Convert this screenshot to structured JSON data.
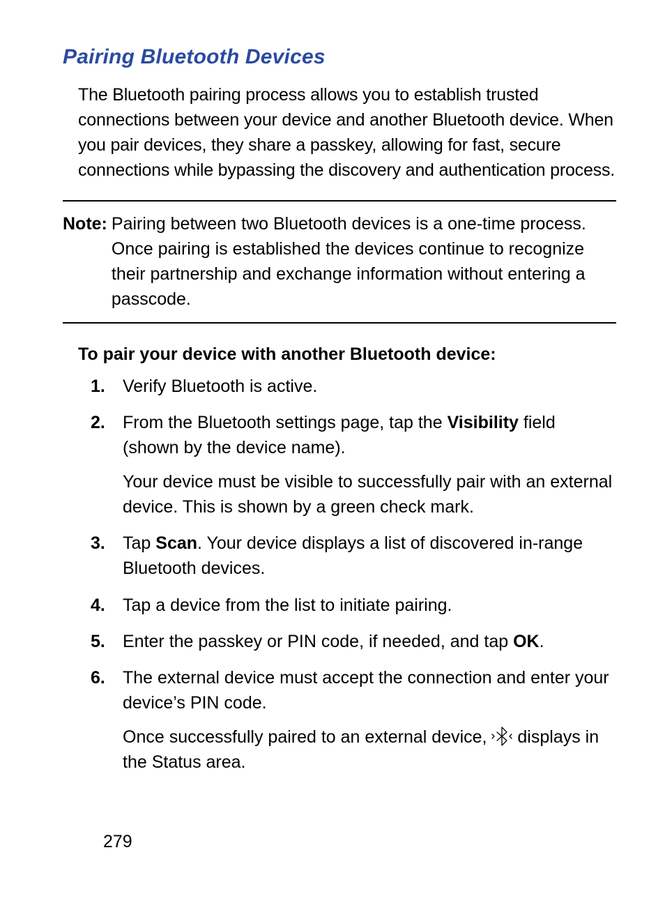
{
  "heading": "Pairing Bluetooth Devices",
  "intro": "The Bluetooth pairing process allows you to establish trusted connections between your device and another Bluetooth device. When you pair devices, they share a passkey, allowing for fast, secure connections while bypassing the discovery and authentication process.",
  "note_label": "Note:",
  "note_text": "Pairing between two Bluetooth devices is a one-time process. Once pairing is established the devices continue to recognize their partnership and exchange information without entering a passcode.",
  "procedure_heading": "To pair your device with another Bluetooth device:",
  "steps": {
    "s1": "Verify Bluetooth is active.",
    "s2_a": "From the Bluetooth settings page, tap the ",
    "s2_bold": "Visibility",
    "s2_b": " field (shown by the device name).",
    "s2_extra": "Your device must be visible to successfully pair with an external device. This is shown by a green check mark.",
    "s3_a": "Tap ",
    "s3_bold": "Scan",
    "s3_b": ". Your device displays a list of discovered in-range Bluetooth devices.",
    "s4": "Tap a device from the list to initiate pairing.",
    "s5_a": "Enter the passkey or PIN code, if needed, and tap ",
    "s5_bold": "OK",
    "s5_b": ".",
    "s6_a": "The external device must accept the connection and enter your device’s PIN code.",
    "s6_extra_a": "Once successfully paired to an external device, ",
    "s6_extra_b": " displays in the Status area."
  },
  "page_number": "279"
}
